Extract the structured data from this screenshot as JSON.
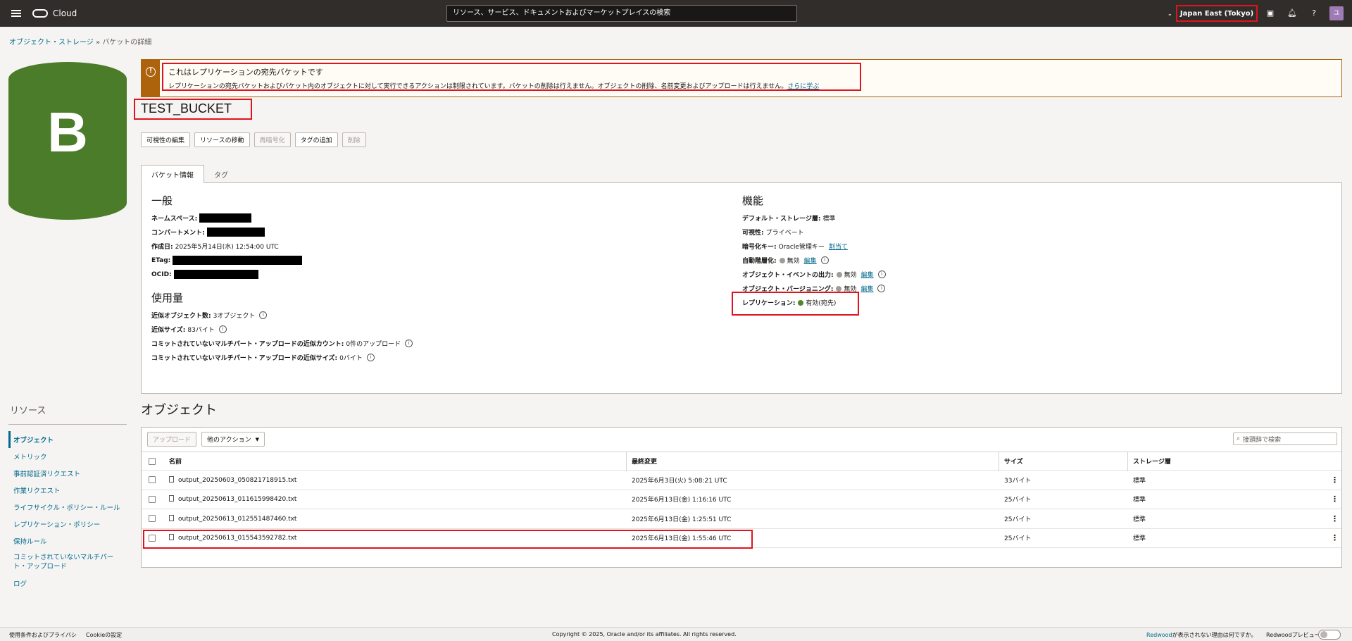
{
  "header": {
    "brand": "Cloud",
    "search_placeholder": "リソース、サービス、ドキュメントおよびマーケットプレイスの検索",
    "region": "Japan East (Tokyo)",
    "avatar_initial": "ユ"
  },
  "breadcrumb": {
    "parent": "オブジェクト・ストレージ",
    "separator": "»",
    "current": "バケットの詳細"
  },
  "avatar_letter": "B",
  "banner": {
    "title": "これはレプリケーションの宛先バケットです",
    "message": "レプリケーションの宛先バケットおよびバケット内のオブジェクトに対して実行できるアクションは制限されています。バケットの削除は行えません。オブジェクトの削除、名前変更およびアップロードは行えません。",
    "link": "さらに学ぶ"
  },
  "bucket_name": "TEST_BUCKET",
  "actions": [
    {
      "label": "可視性の編集",
      "disabled": false
    },
    {
      "label": "リソースの移動",
      "disabled": false
    },
    {
      "label": "再暗号化",
      "disabled": true
    },
    {
      "label": "タグの追加",
      "disabled": false
    },
    {
      "label": "削除",
      "disabled": true
    }
  ],
  "tabs": [
    "バケット情報",
    "タグ"
  ],
  "general": {
    "heading": "一般",
    "namespace_label": "ネームスペース:",
    "compartment_label": "コンパートメント:",
    "created_label": "作成日:",
    "created_value": "2025年5月14日(水) 12:54:00 UTC",
    "etag_label": "ETag:",
    "ocid_label": "OCID:"
  },
  "usage": {
    "heading": "使用量",
    "count_label": "近似オブジェクト数:",
    "count_value": "3オブジェクト",
    "size_label": "近似サイズ:",
    "size_value": "83バイト",
    "mp_count_label": "コミットされていないマルチパート・アップロードの近似カウント:",
    "mp_count_value": "0件のアップロード",
    "mp_size_label": "コミットされていないマルチパート・アップロードの近似サイズ:",
    "mp_size_value": "0バイト"
  },
  "features": {
    "heading": "機能",
    "storage_tier_label": "デフォルト・ストレージ層:",
    "storage_tier_value": "標準",
    "visibility_label": "可視性:",
    "visibility_value": "プライベート",
    "encryption_label": "暗号化キー:",
    "encryption_value": "Oracle管理キー",
    "encryption_link": "割当て",
    "auto_tier_label": "自動階層化:",
    "auto_tier_value": "無効",
    "auto_tier_link": "編集",
    "events_label": "オブジェクト・イベントの出力:",
    "events_value": "無効",
    "events_link": "編集",
    "versioning_label": "オブジェクト・バージョニング:",
    "versioning_value": "無効",
    "versioning_link": "編集",
    "replication_label": "レプリケーション:",
    "replication_value": "有効(宛先)"
  },
  "resources": {
    "heading": "リソース",
    "items": [
      "オブジェクト",
      "メトリック",
      "事前認証済リクエスト",
      "作業リクエスト",
      "ライフサイクル・ポリシー・ルール",
      "レプリケーション・ポリシー",
      "保持ルール",
      "コミットされていないマルチパート・アップロード",
      "ログ"
    ]
  },
  "objects": {
    "heading": "オブジェクト",
    "upload_label": "アップロード",
    "more_actions_label": "他のアクション",
    "filter_placeholder": "接頭辞で検索",
    "columns": [
      "名前",
      "最終変更",
      "サイズ",
      "ストレージ層"
    ],
    "rows": [
      {
        "name": "output_20250603_050821718915.txt",
        "modified": "2025年6月3日(火) 5:08:21 UTC",
        "size": "33バイト",
        "tier": "標準"
      },
      {
        "name": "output_20250613_011615998420.txt",
        "modified": "2025年6月13日(金) 1:16:16 UTC",
        "size": "25バイト",
        "tier": "標準"
      },
      {
        "name": "output_20250613_012551487460.txt",
        "modified": "2025年6月13日(金) 1:25:51 UTC",
        "size": "25バイト",
        "tier": "標準"
      },
      {
        "name": "output_20250613_015543592782.txt",
        "modified": "2025年6月13日(金) 1:55:46 UTC",
        "size": "25バイト",
        "tier": "標準"
      }
    ]
  },
  "footer": {
    "terms": "使用条件およびプライバシ",
    "cookies": "Cookieの設定",
    "copyright": "Copyright © 2025, Oracle and/or its affiliates. All rights reserved.",
    "redwood_link": "Redwood",
    "redwood_text": "が表示されない理由は何ですか。",
    "redwood_preview": "Redwoodプレビュー"
  }
}
